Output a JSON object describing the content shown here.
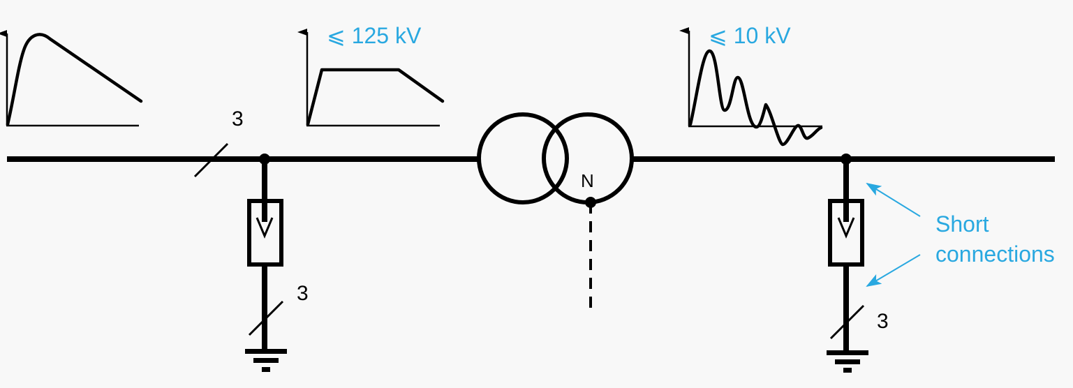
{
  "colors": {
    "line": "#000000",
    "accent": "#29a8e0",
    "background": "#f8f8f8"
  },
  "waveforms": {
    "lightning": {
      "label": ""
    },
    "transmitted": {
      "label": "⩽ 125 kV"
    },
    "secondary": {
      "label": "⩽ 10 kV"
    }
  },
  "labels": {
    "line_phase_count": "3",
    "left_arrester_phase_count": "3",
    "right_arrester_phase_count": "3",
    "neutral": "N"
  },
  "annotation": {
    "line1": "Short",
    "line2": "connections"
  },
  "icons": {
    "surge_arrester": "surge-arrester-symbol",
    "ground": "ground-symbol",
    "transformer": "two-winding-transformer-symbol"
  }
}
